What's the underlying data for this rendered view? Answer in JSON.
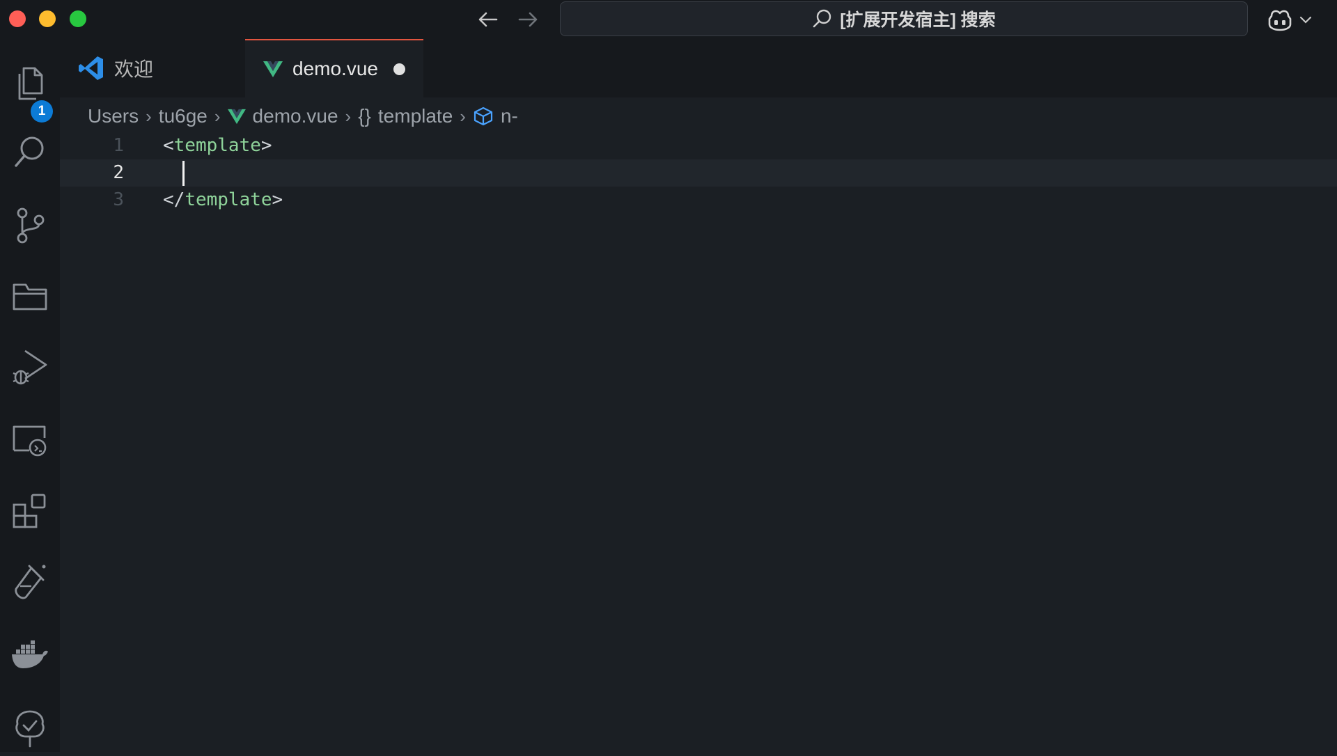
{
  "window": {
    "command_center_text": "[扩展开发宿主] 搜索"
  },
  "tabs": [
    {
      "label": "欢迎",
      "icon": "vscode-logo-icon",
      "active": false
    },
    {
      "label": "demo.vue",
      "icon": "vue-logo-icon",
      "active": true,
      "dirty": true
    }
  ],
  "breadcrumbs": [
    {
      "label": "Users"
    },
    {
      "label": "tu6ge"
    },
    {
      "label": "demo.vue",
      "icon": "vue-logo-icon"
    },
    {
      "label": "template",
      "icon": "braces-icon"
    },
    {
      "label": "n-",
      "icon": "cube-icon"
    }
  ],
  "activity_bar": {
    "items": [
      {
        "name": "explorer",
        "icon": "files-icon",
        "badge": "1"
      },
      {
        "name": "search",
        "icon": "search-icon"
      },
      {
        "name": "source-control",
        "icon": "source-control-icon"
      },
      {
        "name": "folders",
        "icon": "folder-icon"
      },
      {
        "name": "run-debug",
        "icon": "run-debug-icon"
      },
      {
        "name": "remote-explorer",
        "icon": "remote-explorer-icon"
      },
      {
        "name": "extensions",
        "icon": "extensions-icon"
      },
      {
        "name": "testing",
        "icon": "testing-flask-icon"
      },
      {
        "name": "docker",
        "icon": "docker-icon"
      },
      {
        "name": "tree-view",
        "icon": "tree-icon"
      }
    ]
  },
  "editor": {
    "current_line": 2,
    "lines": [
      {
        "number": "1",
        "open": "<",
        "tag": "template",
        "close": ">"
      },
      {
        "number": "2",
        "open": "",
        "tag": "",
        "close": ""
      },
      {
        "number": "3",
        "open": "</",
        "tag": "template",
        "close": ">"
      }
    ]
  },
  "colors": {
    "background": "#1b1f24",
    "tab_active_border": "#e2553f",
    "badge": "#0c7bd6",
    "vue_green": "#41b883",
    "tag_green": "#8fd39a",
    "breadcrumb_icon_blue": "#4aa3ff"
  }
}
